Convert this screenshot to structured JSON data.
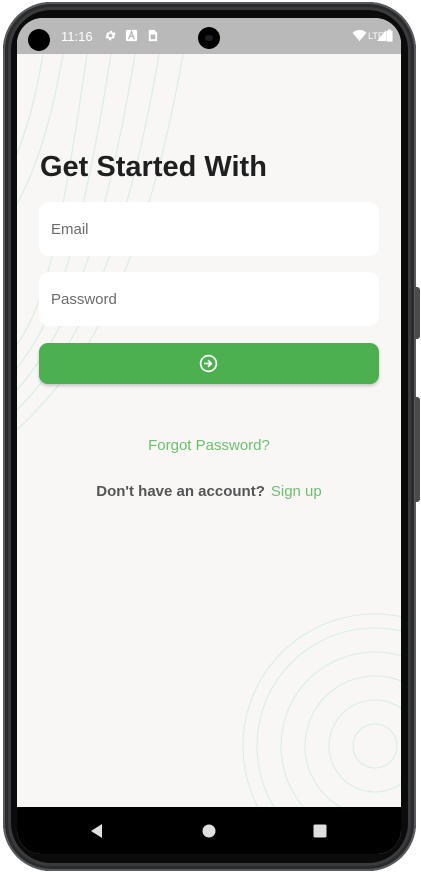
{
  "status_bar": {
    "time": "11:16",
    "network": "LTE",
    "icons": [
      "settings-icon",
      "a-notification-icon",
      "sim-card-icon",
      "wifi-icon",
      "signal-icon",
      "battery-icon"
    ]
  },
  "login": {
    "title": "Get Started With",
    "email_placeholder": "Email",
    "password_placeholder": "Password",
    "submit_icon": "arrow-right-circle-icon",
    "forgot_password": "Forgot Password?",
    "no_account_prompt": "Don't have an account?",
    "sign_up": "Sign up"
  },
  "nav_bar": {
    "icons": [
      "back-icon",
      "home-icon",
      "recents-icon"
    ]
  },
  "colors": {
    "primary": "#4caf50",
    "link": "#6cc070",
    "background": "#f8f7f5",
    "status_bar": "#b9b9b9"
  }
}
